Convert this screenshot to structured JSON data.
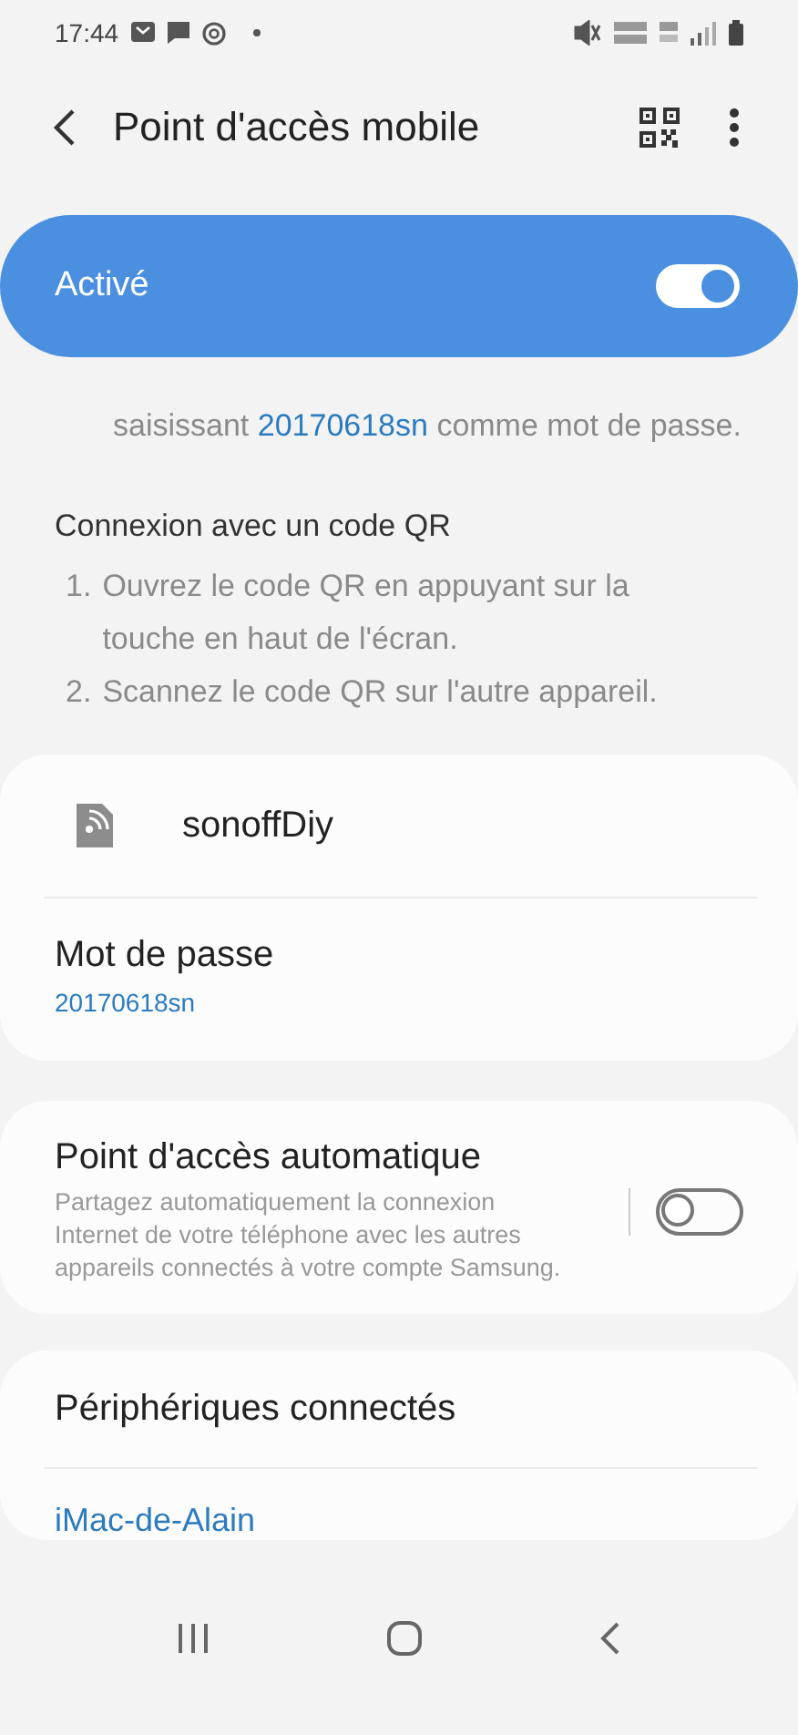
{
  "status_bar": {
    "time": "17:44"
  },
  "app_bar": {
    "title": "Point d'accès mobile"
  },
  "master_switch": {
    "label": "Activé",
    "on": true
  },
  "password_hint": "saisissant **20170618sn** comme mot de passe.",
  "qr_section": {
    "heading": "Connexion avec un code QR",
    "steps": [
      {
        "number": "1.",
        "text": "Ouvrez le code QR en appuyant sur la touche en haut de l'écran."
      },
      {
        "number": "2.",
        "text": "Scannez le code QR sur l'autre appareil."
      }
    ]
  },
  "network_card": {
    "name": "sonoffDiy",
    "password_label": "Mot de passe",
    "password_value": "20170618sn"
  },
  "auto_hotspot": {
    "title": "Point d'accès automatique",
    "description": "Partagez automatiquement la connexion Internet de votre téléphone avec les autres appareils connectés à votre compte Samsung.",
    "on": false
  },
  "connected_devices": {
    "heading": "Périphériques connectés",
    "devices": [
      "iMac-de-Alain"
    ]
  }
}
